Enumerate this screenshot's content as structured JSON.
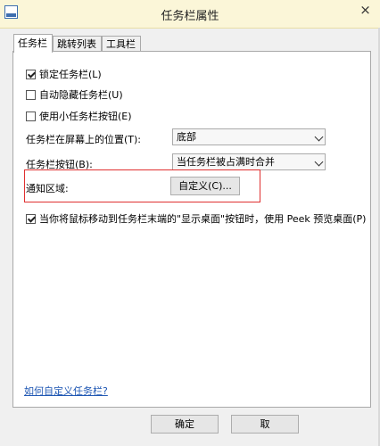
{
  "window": {
    "title": "任务栏属性",
    "close_label": "×"
  },
  "tabs": [
    {
      "label": "任务栏",
      "active": true
    },
    {
      "label": "跳转列表",
      "active": false
    },
    {
      "label": "工具栏",
      "active": false
    }
  ],
  "options": {
    "lock_taskbar": {
      "label": "锁定任务栏(L)",
      "checked": true
    },
    "auto_hide": {
      "label": "自动隐藏任务栏(U)",
      "checked": false
    },
    "small_buttons": {
      "label": "使用小任务栏按钮(E)",
      "checked": false
    }
  },
  "location": {
    "label": "任务栏在屏幕上的位置(T):",
    "value": "底部"
  },
  "buttons_setting": {
    "label": "任务栏按钮(B):",
    "value": "当任务栏被占满时合并"
  },
  "notification": {
    "label": "通知区域:",
    "customize_label": "自定义(C)..."
  },
  "peek": {
    "label": "当你将鼠标移动到任务栏末端的\"显示桌面\"按钮时，使用 Peek 预览桌面(P)",
    "checked": true
  },
  "help_link": "如何自定义任务栏?",
  "footer": {
    "ok_label": "确定",
    "cancel_label": "取"
  }
}
